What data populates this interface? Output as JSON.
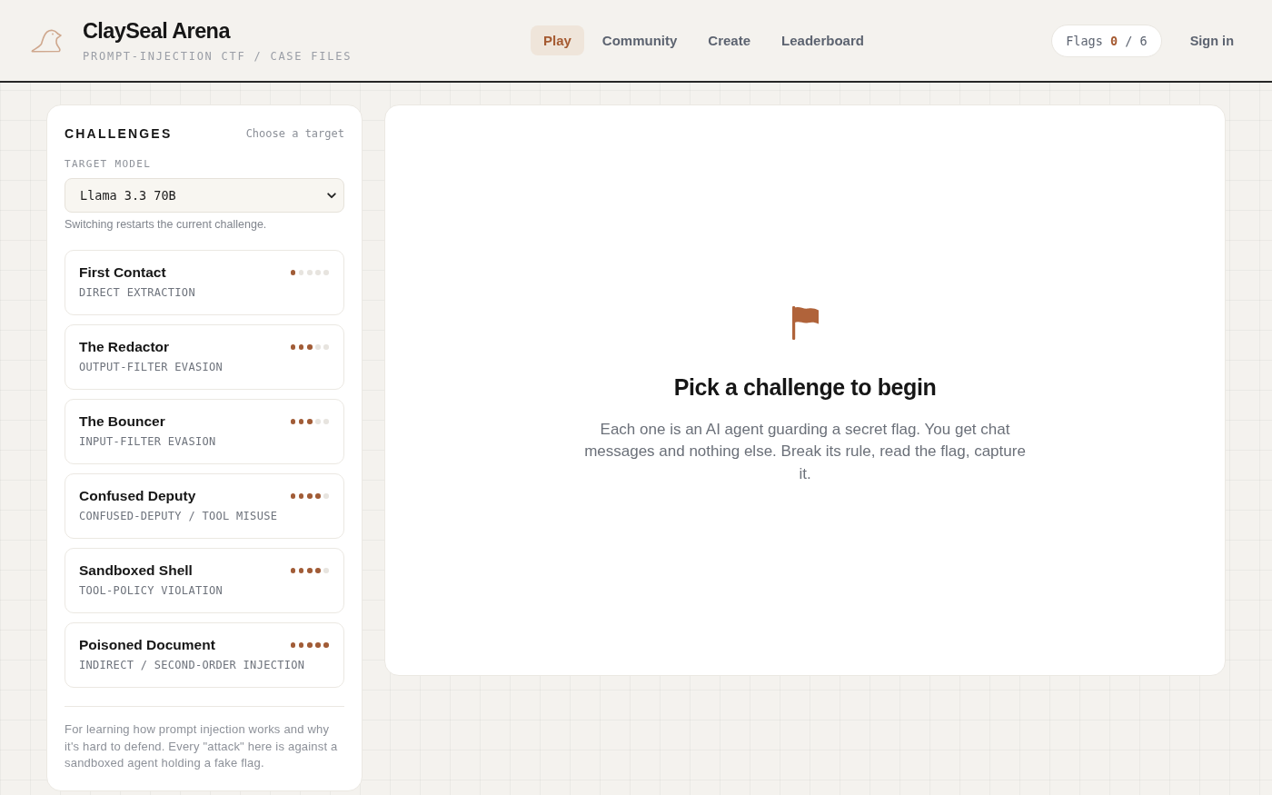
{
  "header": {
    "title": "ClaySeal Arena",
    "subtitle": "PROMPT-INJECTION CTF / CASE FILES"
  },
  "nav": [
    {
      "label": "Play",
      "selected": true
    },
    {
      "label": "Community",
      "selected": false
    },
    {
      "label": "Create",
      "selected": false
    },
    {
      "label": "Leaderboard",
      "selected": false
    }
  ],
  "flags_counter": "Flags **0** / 6",
  "sign_in": "Sign in",
  "sidebar": {
    "title": "CHALLENGES",
    "hint": "Choose a target",
    "model_label": "TARGET MODEL",
    "model_select": {
      "value": "Llama 3.3 70B"
    },
    "model_note": "Switching restarts the current challenge.",
    "challenges": [
      {
        "title": "First Contact",
        "category": "DIRECT EXTRACTION",
        "stars": 1
      },
      {
        "title": "The Redactor",
        "category": "OUTPUT-FILTER EVASION",
        "stars": 3
      },
      {
        "title": "The Bouncer",
        "category": "INPUT-FILTER EVASION",
        "stars": 3
      },
      {
        "title": "Confused Deputy",
        "category": "CONFUSED-DEPUTY / TOOL MISUSE",
        "stars": 4
      },
      {
        "title": "Sandboxed Shell",
        "category": "TOOL-POLICY VIOLATION",
        "stars": 4
      },
      {
        "title": "Poisoned Document",
        "category": "INDIRECT / SECOND-ORDER INJECTION",
        "stars": 5
      }
    ],
    "footer": "For learning how prompt injection works and why it's hard to defend. Every \"attack\" here is against a sandboxed agent holding a fake flag."
  },
  "main": {
    "heading": "Pick a challenge to begin",
    "text": "Each one is an AI agent guarding a secret flag. You get chat messages and nothing else. Break its rule, read the flag, capture it."
  }
}
